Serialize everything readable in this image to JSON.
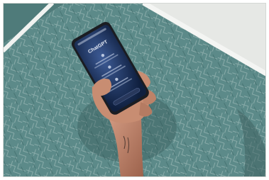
{
  "photo": {
    "description_free": true,
    "phone_screen": {
      "title": "ChatGPT"
    },
    "colors": {
      "table": "#5c8a89",
      "table_dark": "#426f6e",
      "table_line": "#9db9b7",
      "floor": "#e6e8e5",
      "phone_body": "#1b1d22",
      "screen": "#0f1f3e",
      "screen_glow": "#3d5b96",
      "skin": "#c88d72",
      "skin_shadow": "#9c624c"
    }
  }
}
